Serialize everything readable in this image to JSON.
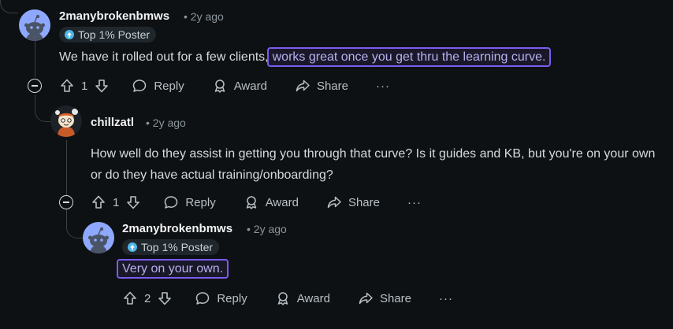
{
  "comments": [
    {
      "author": "2manybrokenbmws",
      "meta": "• 2y ago",
      "badge": "Top 1% Poster",
      "text_plain": "We have it rolled out for a few clients,",
      "text_highlight": "works great once you get thru the learning curve.",
      "votes": "1",
      "reply_label": "Reply",
      "award_label": "Award",
      "share_label": "Share",
      "more_label": "···"
    },
    {
      "author": "chillzatl",
      "meta": "• 2y ago",
      "text_plain": "How well do they assist in getting you through that curve? Is it guides and KB, but you're on your own or do they have actual training/onboarding?",
      "votes": "1",
      "reply_label": "Reply",
      "award_label": "Award",
      "share_label": "Share",
      "more_label": "···"
    },
    {
      "author": "2manybrokenbmws",
      "meta": "• 2y ago",
      "badge": "Top 1% Poster",
      "text_highlight": "Very on your own.",
      "votes": "2",
      "reply_label": "Reply",
      "award_label": "Award",
      "share_label": "Share",
      "more_label": "···"
    }
  ],
  "colors": {
    "background": "#0e1113",
    "highlight": "#7b5cf0",
    "avatar_blue": "#8fa8ff"
  }
}
